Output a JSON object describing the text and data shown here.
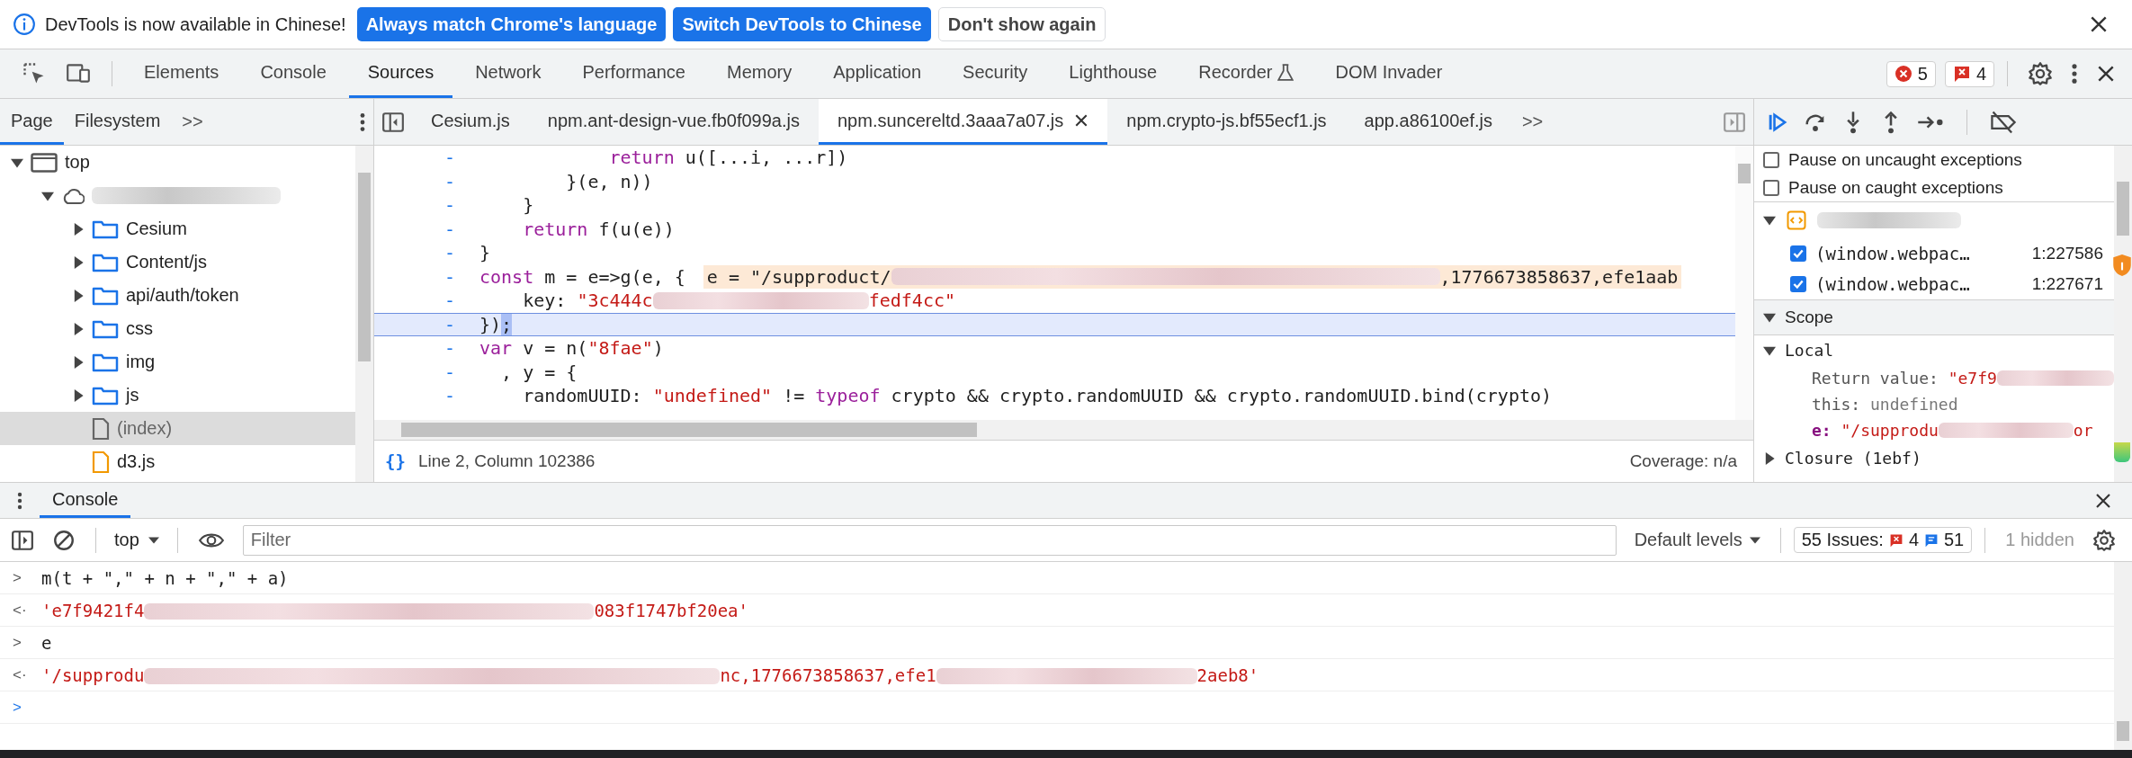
{
  "infobar": {
    "message": "DevTools is now available in Chinese!",
    "buttons": [
      {
        "label": "Always match Chrome's language",
        "kind": "primary"
      },
      {
        "label": "Switch DevTools to Chinese",
        "kind": "primary"
      },
      {
        "label": "Don't show again",
        "kind": "secondary"
      }
    ]
  },
  "tabs": [
    {
      "label": "Elements",
      "selected": false
    },
    {
      "label": "Console",
      "selected": false
    },
    {
      "label": "Sources",
      "selected": true
    },
    {
      "label": "Network",
      "selected": false
    },
    {
      "label": "Performance",
      "selected": false
    },
    {
      "label": "Memory",
      "selected": false
    },
    {
      "label": "Application",
      "selected": false
    },
    {
      "label": "Security",
      "selected": false
    },
    {
      "label": "Lighthouse",
      "selected": false
    },
    {
      "label": "Recorder",
      "selected": false,
      "flask": true
    },
    {
      "label": "DOM Invader",
      "selected": false
    }
  ],
  "counters": {
    "errors": "5",
    "issues": "4"
  },
  "navigator": {
    "tabs": [
      {
        "label": "Page",
        "selected": true
      },
      {
        "label": "Filesystem",
        "selected": false
      }
    ],
    "more": ">>",
    "tree": [
      {
        "kind": "frame",
        "label": "top",
        "expanded": true,
        "selected": false,
        "children": [
          {
            "kind": "origin",
            "expanded": true,
            "selected": false,
            "children": [
              {
                "kind": "folder",
                "label": "Cesium",
                "expanded": false,
                "selected": false
              },
              {
                "kind": "folder",
                "label": "Content/js",
                "expanded": false,
                "selected": false
              },
              {
                "kind": "folder",
                "label": "api/auth/token",
                "expanded": false,
                "selected": false
              },
              {
                "kind": "folder",
                "label": "css",
                "expanded": false,
                "selected": false
              },
              {
                "kind": "folder",
                "label": "img",
                "expanded": false,
                "selected": false
              },
              {
                "kind": "folder",
                "label": "js",
                "expanded": false,
                "selected": false
              },
              {
                "kind": "document",
                "label": "(index)",
                "selected": true
              },
              {
                "kind": "script",
                "label": "d3.js",
                "selected": false
              }
            ]
          }
        ]
      }
    ]
  },
  "editor": {
    "tabs": [
      {
        "label": "Cesium.js",
        "selected": false
      },
      {
        "label": "npm.ant-design-vue.fb0f099a.js",
        "selected": false
      },
      {
        "label": "npm.suncereltd.3aaa7a07.js",
        "selected": true
      },
      {
        "label": "npm.crypto-js.bf55ecf1.js",
        "selected": false
      },
      {
        "label": "app.a86100ef.js",
        "selected": false
      }
    ],
    "more": ">>",
    "lines": [
      {
        "gutter": "-",
        "current": false,
        "parts": [
          {
            "kind": "keyword",
            "text": "            return"
          },
          {
            "kind": "plain",
            "text": " u([...i, ...r])"
          }
        ]
      },
      {
        "gutter": "-",
        "current": false,
        "parts": [
          {
            "kind": "plain",
            "text": "        }(e, n))"
          }
        ]
      },
      {
        "gutter": "-",
        "current": false,
        "parts": [
          {
            "kind": "plain",
            "text": "    }"
          }
        ]
      },
      {
        "gutter": "-",
        "current": false,
        "parts": [
          {
            "kind": "keyword",
            "text": "    return"
          },
          {
            "kind": "plain",
            "text": " f(u(e))"
          }
        ]
      },
      {
        "gutter": "-",
        "current": false,
        "parts": [
          {
            "kind": "plain",
            "text": "}"
          }
        ]
      },
      {
        "gutter": "-",
        "current": false,
        "parts": [
          {
            "kind": "keyword",
            "text": "const"
          },
          {
            "kind": "plain",
            "text": " m = e=>g(e, {"
          }
        ],
        "preview": [
          {
            "kind": "plain",
            "text": "e = \"/supproduct/"
          },
          {
            "kind": "redacted"
          },
          {
            "kind": "plain",
            "text": ",1776673858637,efe1aab"
          }
        ]
      },
      {
        "gutter": "-",
        "current": false,
        "parts": [
          {
            "kind": "plain",
            "text": "    key: "
          },
          {
            "kind": "string",
            "text": "\"3c444c"
          },
          {
            "kind": "redacted"
          },
          {
            "kind": "string",
            "text": "fedf4cc\""
          }
        ]
      },
      {
        "gutter": "-",
        "current": true,
        "parts": [
          {
            "kind": "plain",
            "text": "})"
          },
          {
            "kind": "selection",
            "text": ";"
          }
        ]
      },
      {
        "gutter": "-",
        "current": false,
        "parts": [
          {
            "kind": "keyword",
            "text": "var"
          },
          {
            "kind": "plain",
            "text": " v = n("
          },
          {
            "kind": "string",
            "text": "\"8fae\""
          },
          {
            "kind": "plain",
            "text": ")"
          }
        ]
      },
      {
        "gutter": "-",
        "current": false,
        "parts": [
          {
            "kind": "plain",
            "text": "  , y = {"
          }
        ]
      },
      {
        "gutter": "-",
        "current": false,
        "parts": [
          {
            "kind": "plain",
            "text": "    randomUUID: "
          },
          {
            "kind": "string",
            "text": "\"undefined\""
          },
          {
            "kind": "plain",
            "text": " != "
          },
          {
            "kind": "keyword",
            "text": "typeof"
          },
          {
            "kind": "plain",
            "text": " crypto && crypto.randomUUID && crypto.randomUUID.bind(crypto)"
          }
        ]
      }
    ],
    "pretty_print": "{}",
    "status": "Line 2, Column 102386",
    "coverage": "Coverage: n/a"
  },
  "debugger": {
    "exceptions": [
      {
        "label": "Pause on uncaught exceptions",
        "checked": false
      },
      {
        "label": "Pause on caught exceptions",
        "checked": false
      }
    ],
    "breakpoints": [
      {
        "label": "(window.webpac…",
        "location": "1:227586",
        "checked": true
      },
      {
        "label": "(window.webpac…",
        "location": "1:227671",
        "checked": true
      }
    ],
    "scope": {
      "title": "Scope",
      "expanded": true,
      "groups": [
        {
          "title": "Local",
          "expanded": true,
          "items": [
            {
              "name": "Return value:",
              "kind": "plain",
              "parts": [
                {
                  "kind": "string",
                  "text": "\"e7f9"
                },
                {
                  "kind": "redacted"
                }
              ]
            },
            {
              "name": "this:",
              "kind": "plain",
              "parts": [
                {
                  "kind": "undefined",
                  "text": "undefined"
                }
              ]
            },
            {
              "name": "e:",
              "kind": "arg",
              "parts": [
                {
                  "kind": "string",
                  "text": "\"/supprodu"
                },
                {
                  "kind": "redacted"
                },
                {
                  "kind": "string",
                  "text": "or"
                }
              ]
            }
          ]
        },
        {
          "title": "Closure (1ebf)",
          "expanded": false
        }
      ]
    }
  },
  "drawer": {
    "tabs": [
      {
        "label": "Console",
        "selected": true
      }
    ],
    "context": "top",
    "filter": {
      "placeholder": "Filter"
    },
    "levels": "Default levels",
    "issues": {
      "label": "55 Issues:",
      "errors": "4",
      "info": "51"
    },
    "hidden": "1 hidden",
    "entries": [
      {
        "kind": "input",
        "marker": ">",
        "parts": [
          {
            "kind": "plain",
            "text": "m(t + \",\" + n + \",\" + a)"
          }
        ]
      },
      {
        "kind": "result",
        "marker": "<·",
        "parts": [
          {
            "kind": "string",
            "text": "'e7f9421f4"
          },
          {
            "kind": "redacted"
          },
          {
            "kind": "string",
            "text": "083f1747bf20ea'"
          }
        ]
      },
      {
        "kind": "input",
        "marker": ">",
        "parts": [
          {
            "kind": "plain",
            "text": "e"
          }
        ]
      },
      {
        "kind": "result",
        "marker": "<·",
        "parts": [
          {
            "kind": "string",
            "text": "'/supprodu"
          },
          {
            "kind": "redacted"
          },
          {
            "kind": "string",
            "text": "nc,1776673858637,efe1"
          },
          {
            "kind": "redacted"
          },
          {
            "kind": "string",
            "text": "2aeb8'"
          }
        ]
      },
      {
        "kind": "prompt",
        "marker": ">"
      }
    ]
  }
}
